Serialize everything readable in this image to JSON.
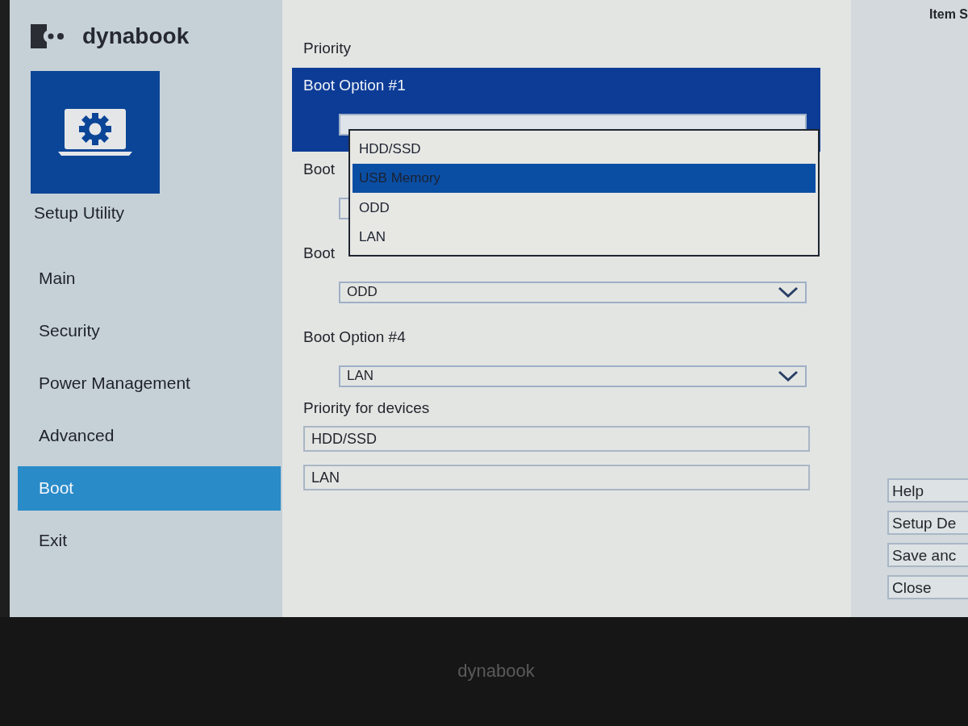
{
  "brand": {
    "name": "dynabook"
  },
  "sidebar": {
    "title": "Setup Utility",
    "items": [
      {
        "label": "Main",
        "selected": false
      },
      {
        "label": "Security",
        "selected": false
      },
      {
        "label": "Power Management",
        "selected": false
      },
      {
        "label": "Advanced",
        "selected": false
      },
      {
        "label": "Boot",
        "selected": true
      },
      {
        "label": "Exit",
        "selected": false
      }
    ]
  },
  "main": {
    "heading": "Priority",
    "boot_options": [
      {
        "label": "Boot Option #1",
        "focused": true
      },
      {
        "label": "Boot",
        "focused": false
      },
      {
        "label": "Boot",
        "focused": false,
        "value": "ODD"
      },
      {
        "label": "Boot Option #4",
        "focused": false,
        "value": "LAN"
      }
    ],
    "dropdown": {
      "options": [
        {
          "label": "HDD/SSD",
          "selected": false
        },
        {
          "label": "USB Memory",
          "selected": true
        },
        {
          "label": "ODD",
          "selected": false
        },
        {
          "label": "LAN",
          "selected": false
        }
      ]
    },
    "devices_heading": "Priority for devices",
    "devices": [
      "HDD/SSD",
      "LAN"
    ]
  },
  "right_panel": {
    "title": "Item S",
    "buttons": [
      "Help",
      "Setup De",
      "Save anc",
      "Close"
    ]
  },
  "bezel": {
    "logo": "dynabook"
  }
}
